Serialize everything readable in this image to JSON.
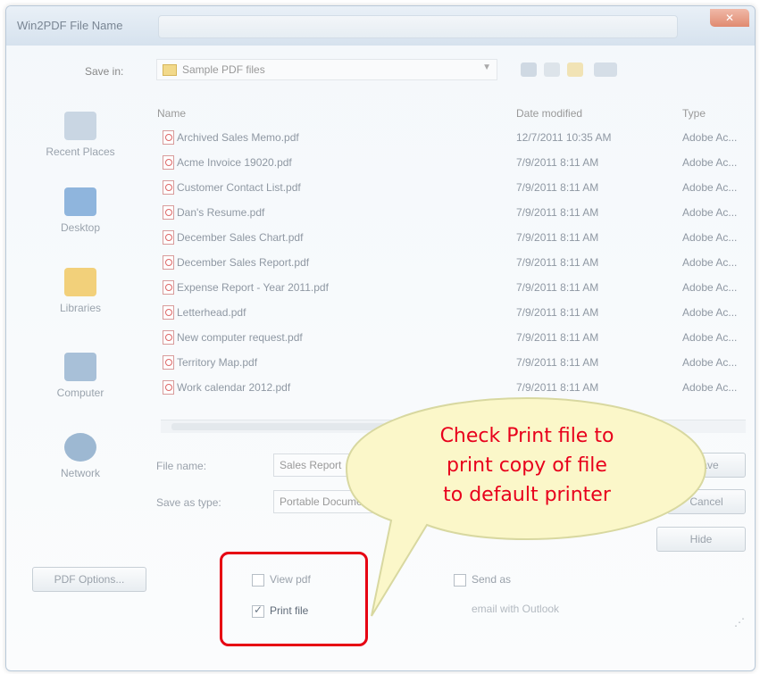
{
  "window": {
    "title": "Win2PDF File Name",
    "close_glyph": "✕"
  },
  "savein": {
    "label": "Save in:",
    "folder": "Sample PDF files"
  },
  "places": [
    {
      "label": "Recent Places",
      "icon": "recent-places-icon",
      "color": "#c9d6e3"
    },
    {
      "label": "Desktop",
      "icon": "desktop-icon",
      "color": "#8fb5dd"
    },
    {
      "label": "Libraries",
      "icon": "libraries-icon",
      "color": "#f2d07a"
    },
    {
      "label": "Computer",
      "icon": "computer-icon",
      "color": "#a8c0d8"
    },
    {
      "label": "Network",
      "icon": "network-icon",
      "color": "#9db8d2"
    }
  ],
  "columns": {
    "name": "Name",
    "date": "Date modified",
    "type": "Type"
  },
  "files": [
    {
      "name": "Archived Sales Memo.pdf",
      "date": "12/7/2011 10:35 AM",
      "type": "Adobe Ac..."
    },
    {
      "name": "Acme Invoice 19020.pdf",
      "date": "7/9/2011 8:11 AM",
      "type": "Adobe Ac..."
    },
    {
      "name": "Customer Contact List.pdf",
      "date": "7/9/2011 8:11 AM",
      "type": "Adobe Ac..."
    },
    {
      "name": "Dan's Resume.pdf",
      "date": "7/9/2011 8:11 AM",
      "type": "Adobe Ac..."
    },
    {
      "name": "December Sales Chart.pdf",
      "date": "7/9/2011 8:11 AM",
      "type": "Adobe Ac..."
    },
    {
      "name": "December Sales Report.pdf",
      "date": "7/9/2011 8:11 AM",
      "type": "Adobe Ac..."
    },
    {
      "name": "Expense Report - Year 2011.pdf",
      "date": "7/9/2011 8:11 AM",
      "type": "Adobe Ac..."
    },
    {
      "name": "Letterhead.pdf",
      "date": "7/9/2011 8:11 AM",
      "type": "Adobe Ac..."
    },
    {
      "name": "New computer request.pdf",
      "date": "7/9/2011 8:11 AM",
      "type": "Adobe Ac..."
    },
    {
      "name": "Territory Map.pdf",
      "date": "7/9/2011 8:11 AM",
      "type": "Adobe Ac..."
    },
    {
      "name": "Work calendar 2012.pdf",
      "date": "7/9/2011 8:11 AM",
      "type": "Adobe Ac..."
    }
  ],
  "form": {
    "filename_label": "File name:",
    "filename_value": "Sales Report",
    "savetype_label": "Save as type:",
    "savetype_value": "Portable Document Format (*.pdf)",
    "save_button": "Save",
    "cancel_button": "Cancel",
    "hide_button": "Hide",
    "pdf_options_button": "PDF Options..."
  },
  "options": {
    "view_pdf": "View pdf",
    "print_file": "Print file",
    "send_as": "Send as",
    "send_sub": "email with Outlook",
    "print_file_checked": true
  },
  "callout": {
    "line1": "Check Print file to",
    "line2": "print copy of file",
    "line3": "to default printer",
    "fill": "#fbf7c9",
    "stroke": "#d8d8a0",
    "text_color": "#e8001c"
  },
  "colors": {
    "highlight": "#e60012"
  }
}
